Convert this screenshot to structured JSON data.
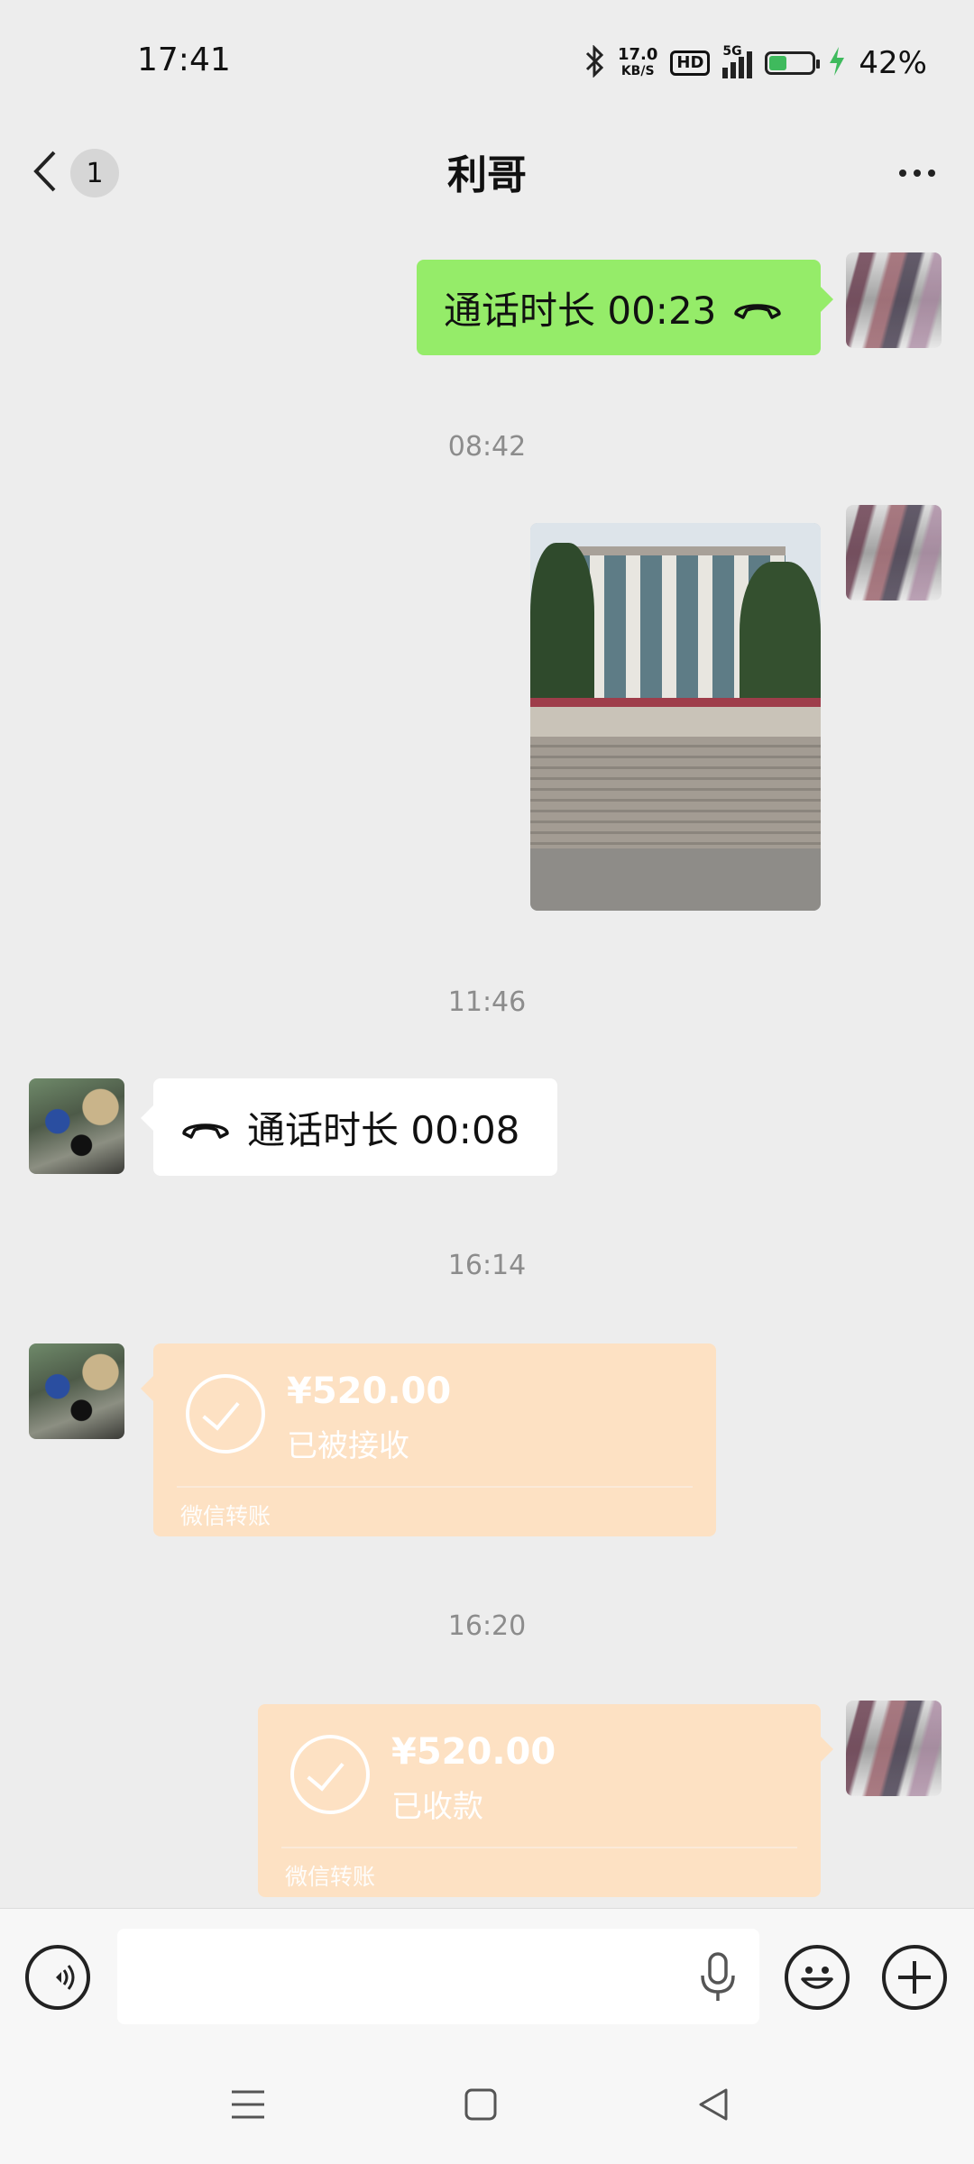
{
  "status_bar": {
    "time": "17:41",
    "speed_value": "17.0",
    "speed_unit": "KB/S",
    "hd": "HD",
    "network": "5G",
    "battery_percent": "42%",
    "battery_level": 0.42,
    "battery_color": "#3fba5d"
  },
  "header": {
    "unread_count": "1",
    "title": "利哥",
    "more_icon": "more-dots-icon",
    "back_icon": "chevron-left-icon"
  },
  "messages": {
    "call_out": {
      "text": "通话时长 00:23",
      "icon": "hangup-icon"
    },
    "ts_1": "08:42",
    "ts_2": "11:46",
    "call_in": {
      "text": "通话时长 00:08",
      "icon": "hangup-icon"
    },
    "ts_3": "16:14",
    "transfer_in": {
      "amount": "¥520.00",
      "status": "已被接收",
      "label": "微信转账"
    },
    "ts_4": "16:20",
    "transfer_out": {
      "amount": "¥520.00",
      "status": "已收款",
      "label": "微信转账"
    }
  },
  "colors": {
    "green_bubble": "#95ec69",
    "transfer_bg": "#fde1c3",
    "background": "#ededed"
  },
  "input_bar": {
    "voice_icon": "voice-toggle-icon",
    "mic_icon": "microphone-icon",
    "emoji_icon": "emoji-icon",
    "plus_icon": "plus-icon",
    "text_value": ""
  },
  "nav_bar": {
    "menu_icon": "menu-icon",
    "home_icon": "home-icon",
    "back_icon": "back-triangle-icon"
  }
}
